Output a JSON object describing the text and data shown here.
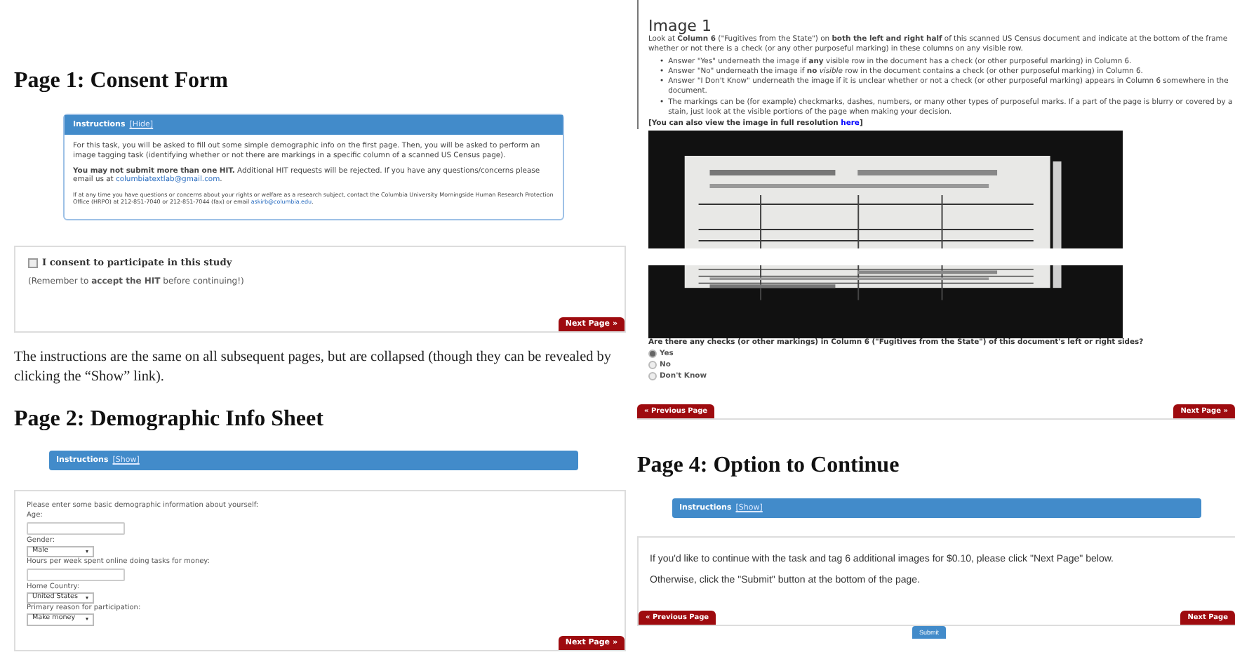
{
  "page1": {
    "heading": "Page 1: Consent Form",
    "instructions": {
      "title": "Instructions",
      "toggle": "[Hide]",
      "paragraphs": [
        {
          "text": "For this task, you will be asked to fill out some simple demographic info on the first page. Then, you will be asked to perform an image tagging task (identifying whether or not there are markings in a specific column of a scanned US Census page).",
          "kind": "standard"
        },
        {
          "text": "**You may not submit more than one HIT.** Additional HIT requests will be rejected. If you have any questions/concerns please email us at ",
          "link": "columbiatextlab@gmail.com",
          "after": ".",
          "kind": "standard"
        },
        {
          "text": "If at any time you have questions or concerns about your rights or welfare as a research subject, contact the Columbia University Morningside Human Research Protection Office (HRPO) at 212-851-7040 or 212-851-7044 (fax) or email ",
          "link": "askirb@columbia.edu",
          "after": ".",
          "kind": "fine_print"
        }
      ]
    },
    "consent": {
      "label": "I consent to participate in this study",
      "checked": false
    },
    "reminder": "(Remember to **accept the HIT** before continuing!)",
    "next_button": "Next Page »"
  },
  "note": "The instructions are the same on all subsequent pages, but are collapsed (though they can be revealed by clicking the “Show” link).",
  "page2": {
    "heading": "Page 2: Demographic Info Sheet",
    "instructions": {
      "title": "Instructions",
      "toggle": "[Show]"
    },
    "intro": "Please enter some basic demographic information about yourself:",
    "fields": [
      {
        "label": "Age:",
        "kind": "text"
      },
      {
        "label": "Gender:",
        "kind": "select",
        "value": "Male"
      },
      {
        "label": "Hours per week spent online doing tasks for money:",
        "kind": "text"
      },
      {
        "label": "Home Country:",
        "kind": "select",
        "value": "United States"
      },
      {
        "label": "Primary reason for participation:",
        "kind": "select",
        "value": "Make money"
      }
    ],
    "next_button": "Next Page »"
  },
  "page3": {
    "title": "Image 1",
    "intro": "Look at **Column 6** (\"Fugitives from the State\") on **both the left and right half** of this scanned US Census document and indicate at the bottom of the frame whether or not there is a check (or any other purposeful marking) in these columns on any visible row.",
    "bullets": [
      {
        "marker": "•",
        "text": "Answer \"Yes\" underneath the image if **any** visible row in the document has a check (or other purposeful marking) in Column 6."
      },
      {
        "marker": "•",
        "text": "Answer \"No\" underneath the image if **no** *visible* row in the document contains a check (or other purposeful marking) in Column 6."
      },
      {
        "marker": "•",
        "text": "Answer \"I Don't Know\" underneath the image if it is unclear whether or not a check (or other purposeful marking) appears in Column 6 somewhere in the document."
      },
      {
        "marker": "•",
        "text": "The markings can be (for example) checkmarks, dashes, numbers, or many other types of purposeful marks. If a part of the page is blurry or covered by a stain, just look at the visible portions of the page when making your decision."
      }
    ],
    "resolution": {
      "text": "[You can also view the image in full resolution ",
      "link": "here",
      "after": "]"
    },
    "question": "Are there any checks (or other markings) in Column 6 (\"Fugitives from the State\") of this document's left or right sides?",
    "options": [
      {
        "label": "Yes",
        "selected": true
      },
      {
        "label": "No",
        "selected": false
      },
      {
        "label": "Don't Know",
        "selected": false
      }
    ],
    "prev_button": "« Previous Page",
    "next_button": "Next Page »"
  },
  "page4": {
    "heading": "Page 4: Option to Continue",
    "instructions": {
      "title": "Instructions",
      "toggle": "[Show]"
    },
    "lines": [
      "If you'd like to continue with the task and tag 6 additional images for $0.10, please click \"Next Page\" below.",
      "Otherwise, click the \"Submit\" button at the bottom of the page."
    ],
    "prev_button": "« Previous Page",
    "next_button": "Next Page",
    "submit_button": "Submit"
  }
}
